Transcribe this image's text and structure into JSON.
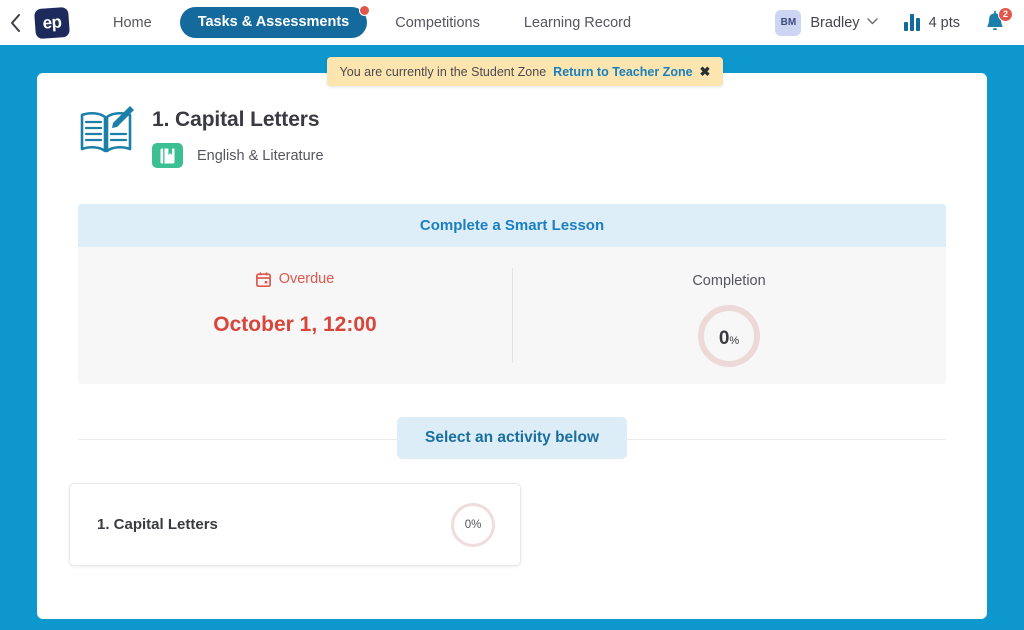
{
  "header": {
    "back_icon": "chevron-left-icon",
    "logo_text": "ep",
    "nav_items": [
      {
        "label": "Home",
        "active": false
      },
      {
        "label": "Tasks & Assessments",
        "active": true
      },
      {
        "label": "Competitions",
        "active": false
      },
      {
        "label": "Learning Record",
        "active": false
      }
    ],
    "user": {
      "avatar_initials": "BM",
      "name": "Bradley",
      "chevron": "▾"
    },
    "points": {
      "icon": "bar-chart-icon",
      "label": "4 pts"
    },
    "notifications": {
      "icon": "bell-icon",
      "count": "2"
    }
  },
  "toast": {
    "message": "You are currently in the Student Zone",
    "link": "Return to Teacher Zone",
    "close": "✖"
  },
  "lesson": {
    "icon": "book-pencil-icon",
    "title": "1. Capital Letters",
    "subject_icon": "book-badge-icon",
    "subject": "English & Literature"
  },
  "info": {
    "banner": "Complete a Smart Lesson",
    "due": {
      "icon": "calendar-icon",
      "status": "Overdue",
      "date": "October 1, 12:00"
    },
    "completion": {
      "label": "Completion",
      "value": "0",
      "unit": "%"
    }
  },
  "select_activity": {
    "label": "Select an activity below"
  },
  "activities": [
    {
      "name": "1. Capital Letters",
      "progress": "0%"
    }
  ],
  "colors": {
    "page_background": "#0e97cc",
    "active_tab": "#146a9c",
    "accent_blue": "#1b7fbf",
    "overdue_red": "#d8453b",
    "subject_green": "#3bbf93",
    "toast_yellow": "#fce5ae",
    "ring_pink": "#eed9d9",
    "logo_navy": "#1d2b5c"
  }
}
